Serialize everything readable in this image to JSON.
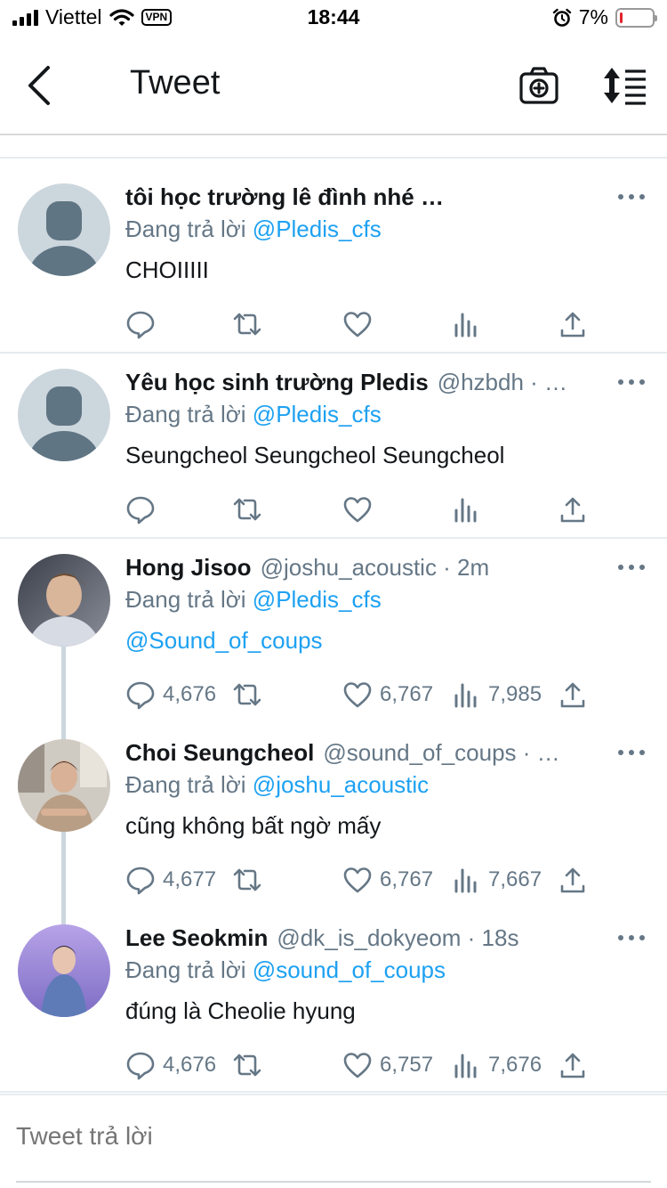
{
  "status_bar": {
    "carrier": "Viettel",
    "vpn": "VPN",
    "time": "18:44",
    "battery_percent": "7%",
    "battery_level": 0.07,
    "icons": [
      "signal-icon",
      "wifi-icon",
      "alarm-icon",
      "battery-icon"
    ]
  },
  "nav": {
    "title": "Tweet",
    "icons": [
      "back-chevron-icon",
      "camera-icon",
      "sort-icon"
    ]
  },
  "colors": {
    "accent": "#1da1f2",
    "text_secondary": "#657786",
    "divider": "#e6ecf0"
  },
  "tweets": [
    {
      "name": "tôi học trường lê đình nhé …",
      "handle": "",
      "replying_prefix": "Đang trả lời",
      "replying_to": "@Pledis_cfs",
      "text": "CHOIIIII",
      "text_is_link": false,
      "reply_count": "",
      "like_count": "",
      "view_count": ""
    },
    {
      "name": "Yêu học sinh trường Pledis",
      "handle": "@hzbdh · …",
      "replying_prefix": "Đang trả lời",
      "replying_to": "@Pledis_cfs",
      "text": "Seungcheol Seungcheol Seungcheol",
      "text_is_link": false,
      "reply_count": "",
      "like_count": "",
      "view_count": ""
    },
    {
      "name": "Hong Jisoo",
      "handle": "@joshu_acoustic · 2m",
      "replying_prefix": "Đang trả lời",
      "replying_to": "@Pledis_cfs",
      "text": "@Sound_of_coups",
      "text_is_link": true,
      "reply_count": "4,676",
      "like_count": "6,767",
      "view_count": "7,985"
    },
    {
      "name": "Choi Seungcheol",
      "handle": "@sound_of_coups · …",
      "replying_prefix": "Đang trả lời",
      "replying_to": "@joshu_acoustic",
      "text": "cũng không bất ngờ mấy",
      "text_is_link": false,
      "reply_count": "4,677",
      "like_count": "6,767",
      "view_count": "7,667"
    },
    {
      "name": "Lee Seokmin",
      "handle": "@dk_is_dokyeom · 18s",
      "replying_prefix": "Đang trả lời",
      "replying_to": "@sound_of_coups",
      "text": "đúng là Cheolie hyung",
      "text_is_link": false,
      "reply_count": "4,676",
      "like_count": "6,757",
      "view_count": "7,676"
    }
  ],
  "reply_bar": {
    "placeholder": "Tweet trả lời"
  }
}
